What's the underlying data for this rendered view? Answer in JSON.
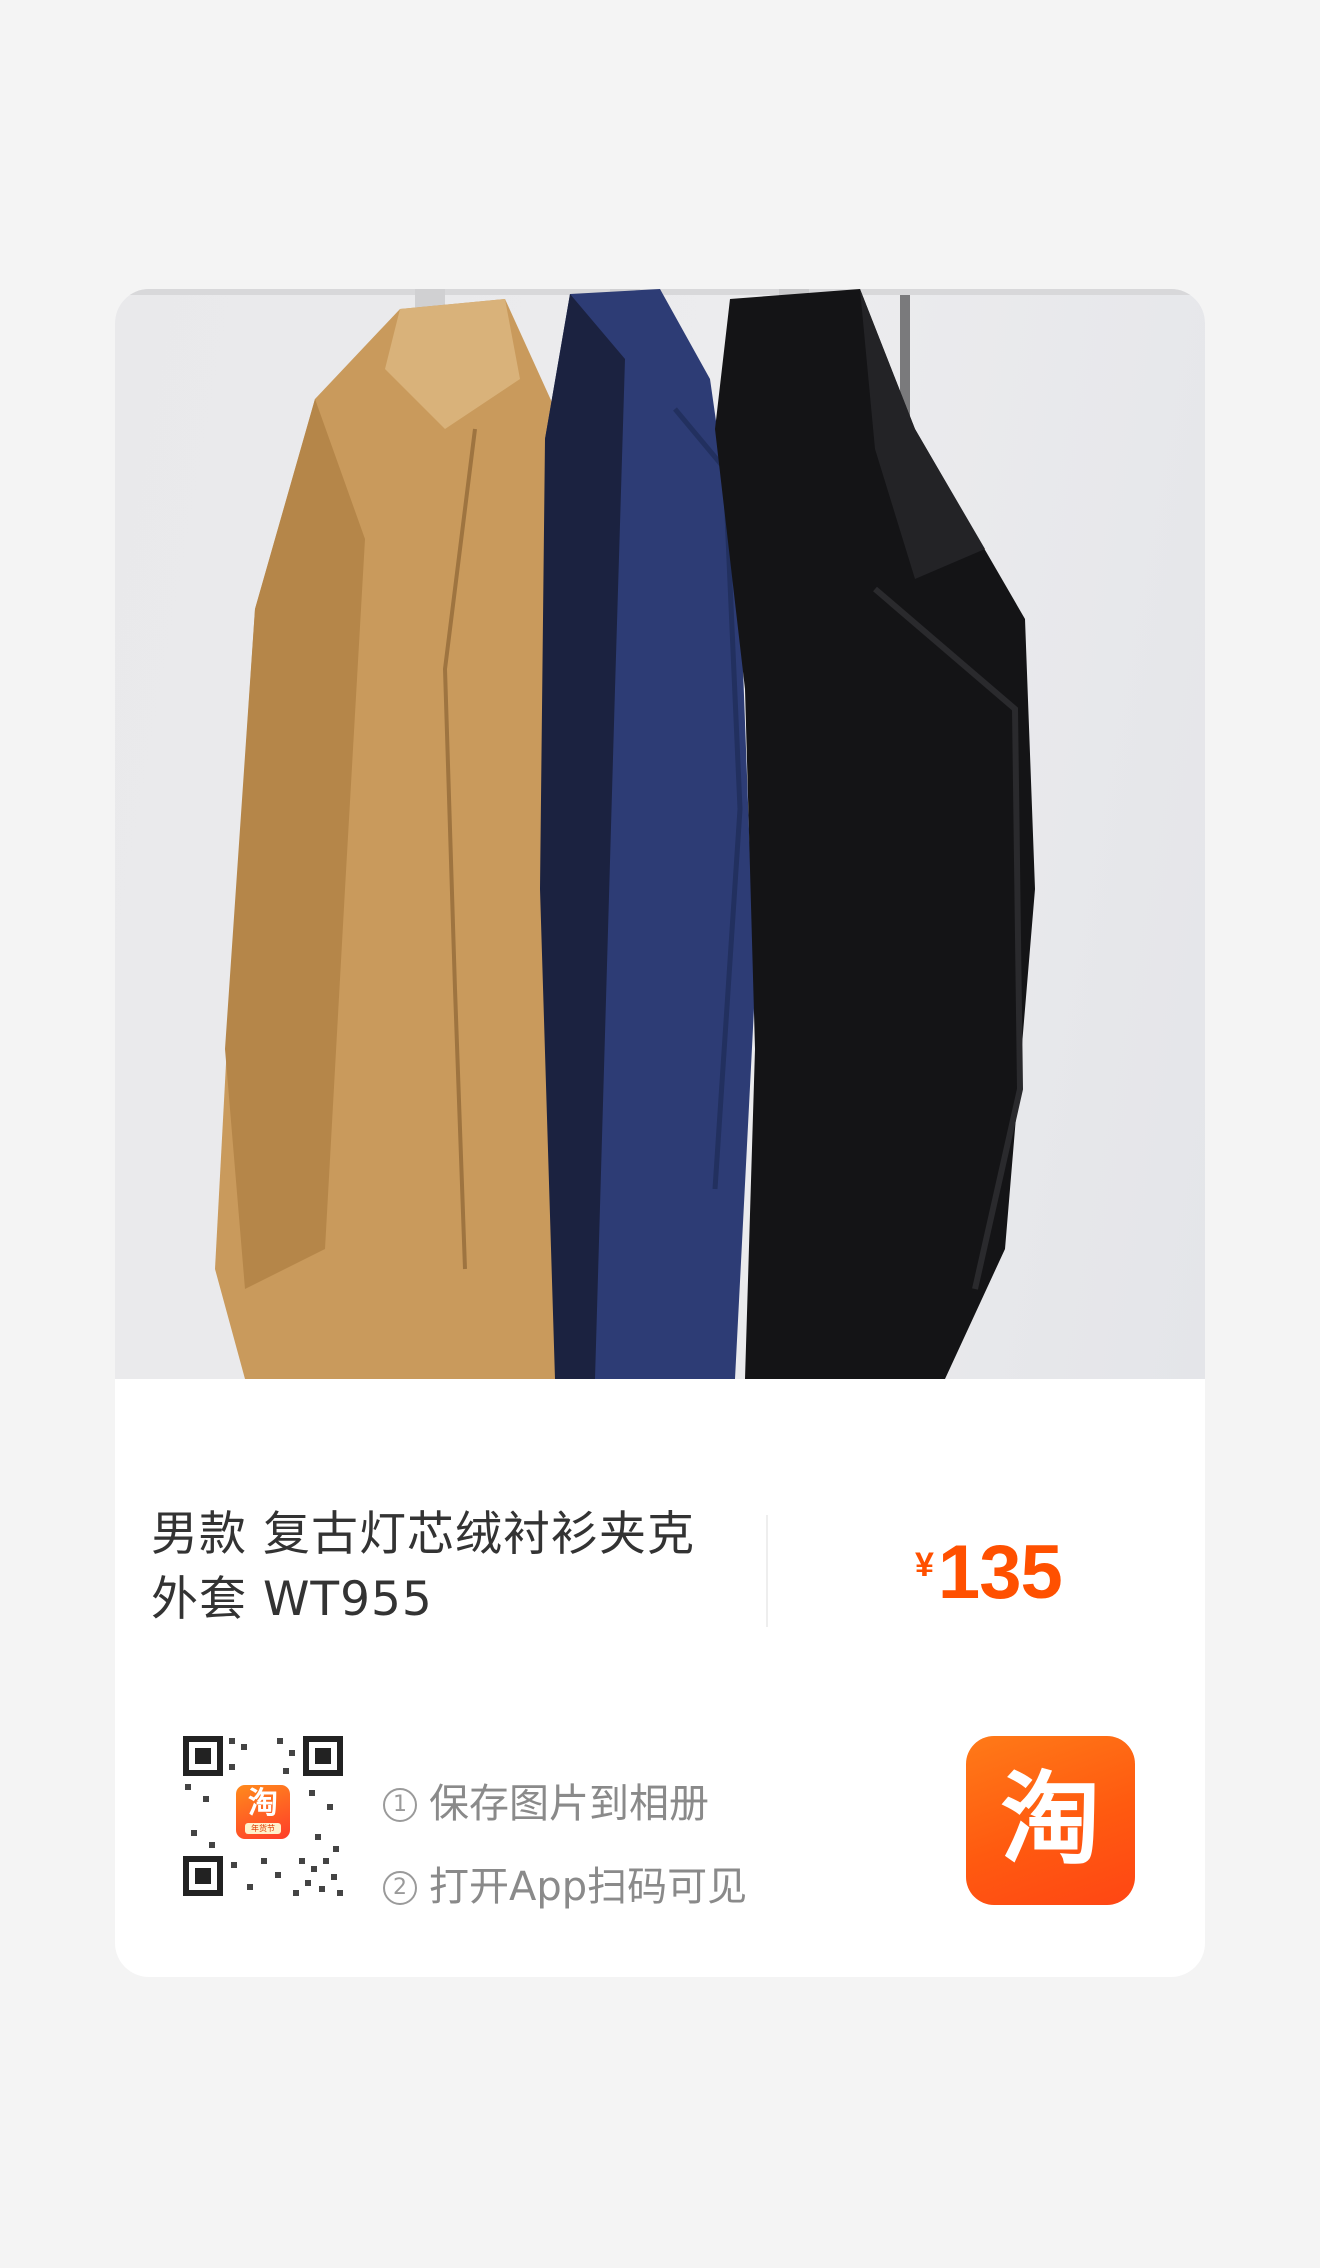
{
  "product": {
    "image_alt": "灯芯绒衬衫夹克 三色",
    "title": "男款 复古灯芯绒衬衫夹克外套 WT955",
    "price_currency": "¥",
    "price_value": "135"
  },
  "share": {
    "qr_logo_glyph": "淘",
    "qr_logo_tag": "年货节",
    "step1_num": "1",
    "step1_text": "保存图片到相册",
    "step2_num": "2",
    "step2_text": "打开App扫码可见"
  },
  "brand": {
    "logo_glyph": "淘"
  },
  "colors": {
    "price": "#ff5000",
    "brand_orange": "#ff5a10",
    "page_bg": "#f4f4f4"
  }
}
